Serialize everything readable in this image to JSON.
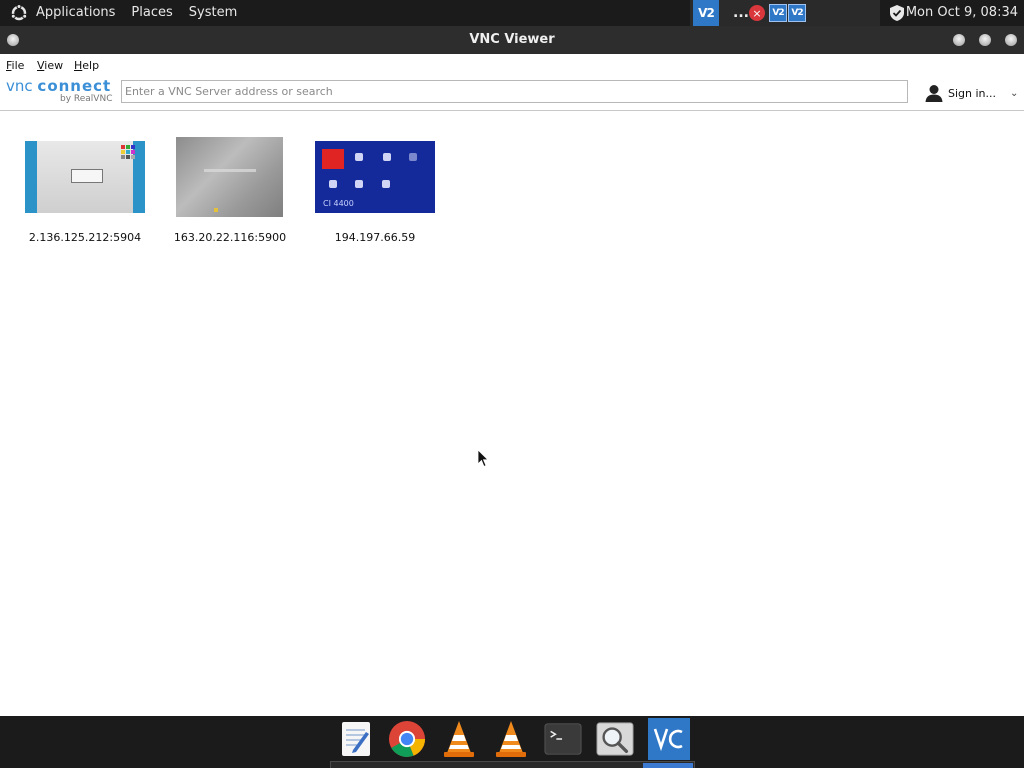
{
  "top_panel": {
    "menus": [
      "Applications",
      "Places",
      "System"
    ],
    "tray_vnc_label": "V2",
    "tray_ellipsis": "...",
    "tray_close_glyph": "×",
    "tray_vnc_small_1": "V2",
    "tray_vnc_small_2": "V2",
    "clock": "Mon Oct  9, 08:34"
  },
  "window": {
    "title": "VNC Viewer"
  },
  "menu_bar": {
    "file": "File",
    "view": "View",
    "help": "Help"
  },
  "toolbar": {
    "logo_vnc": "vnc",
    "logo_connect": "connect",
    "logo_by": "by RealVNC",
    "search_placeholder": "Enter a VNC Server address or search",
    "signin_label": "Sign in...",
    "signin_chevron": "⌄"
  },
  "connections": [
    {
      "label": "2.136.125.212:5904"
    },
    {
      "label": "163.20.22.116:5900"
    },
    {
      "label": "194.197.66.59"
    }
  ],
  "thumbnails": {
    "thumb3_model": "CI 4400"
  },
  "dock": {
    "items": [
      "text-editor-icon",
      "chrome-icon",
      "vlc-icon",
      "vlc-icon",
      "terminal-icon",
      "search-icon",
      "vnc-viewer-icon"
    ]
  },
  "colors": {
    "panel": "#1b1b1b",
    "titlebar": "#2d2d2d",
    "vnc_blue": "#2f78c8",
    "logo_blue": "#3a8fd6"
  }
}
